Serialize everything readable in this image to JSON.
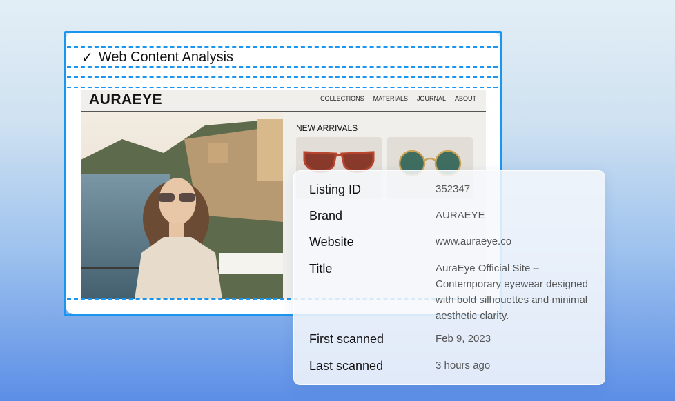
{
  "analysis": {
    "title": "Web Content Analysis"
  },
  "site": {
    "logo": "AURAEYE",
    "nav": [
      "COLLECTIONS",
      "MATERIALS",
      "JOURNAL",
      "ABOUT"
    ],
    "section_title": "NEW ARRIVALS"
  },
  "details": [
    {
      "label": "Listing ID",
      "value": "352347"
    },
    {
      "label": "Brand",
      "value": "AURAEYE"
    },
    {
      "label": "Website",
      "value": "www.auraeye.co"
    },
    {
      "label": "Title",
      "value": "AuraEye Official Site – Contemporary eyewear designed with bold silhouettes and minimal aesthetic clarity."
    },
    {
      "label": "First scanned",
      "value": "Feb 9, 2023"
    },
    {
      "label": "Last scanned",
      "value": "3 hours ago"
    }
  ],
  "colors": {
    "accent": "#1a95f0"
  }
}
